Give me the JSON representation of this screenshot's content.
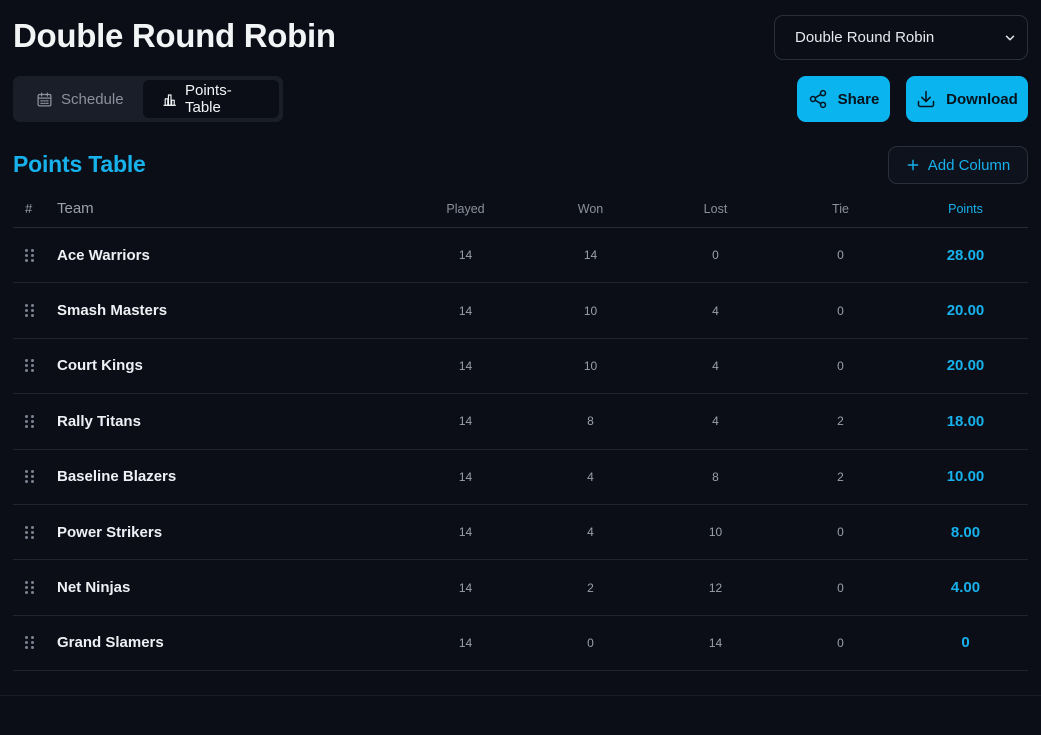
{
  "page": {
    "title": "Double Round Robin"
  },
  "format_select": {
    "selected": "Double Round Robin"
  },
  "tabs": [
    {
      "label": "Schedule",
      "icon": "calendar-icon",
      "active": false
    },
    {
      "label": "Points-Table",
      "icon": "bar-chart-icon",
      "active": true
    }
  ],
  "actions": {
    "share_label": "Share",
    "download_label": "Download"
  },
  "points_table": {
    "title": "Points Table",
    "add_column_label": "Add Column",
    "columns": {
      "index": "#",
      "team": "Team",
      "played": "Played",
      "won": "Won",
      "lost": "Lost",
      "tie": "Tie",
      "points": "Points"
    },
    "rows": [
      {
        "team": "Ace Warriors",
        "played": "14",
        "won": "14",
        "lost": "0",
        "tie": "0",
        "points": "28.00"
      },
      {
        "team": "Smash Masters",
        "played": "14",
        "won": "10",
        "lost": "4",
        "tie": "0",
        "points": "20.00"
      },
      {
        "team": "Court Kings",
        "played": "14",
        "won": "10",
        "lost": "4",
        "tie": "0",
        "points": "20.00"
      },
      {
        "team": "Rally Titans",
        "played": "14",
        "won": "8",
        "lost": "4",
        "tie": "2",
        "points": "18.00"
      },
      {
        "team": "Baseline Blazers",
        "played": "14",
        "won": "4",
        "lost": "8",
        "tie": "2",
        "points": "10.00"
      },
      {
        "team": "Power Strikers",
        "played": "14",
        "won": "4",
        "lost": "10",
        "tie": "0",
        "points": "8.00"
      },
      {
        "team": "Net Ninjas",
        "played": "14",
        "won": "2",
        "lost": "12",
        "tie": "0",
        "points": "4.00"
      },
      {
        "team": "Grand Slamers",
        "played": "14",
        "won": "0",
        "lost": "14",
        "tie": "0",
        "points": "0"
      }
    ]
  },
  "colors": {
    "background": "#0b0e17",
    "accent": "#17b1ec",
    "primary_button": "#0ab4ee"
  }
}
